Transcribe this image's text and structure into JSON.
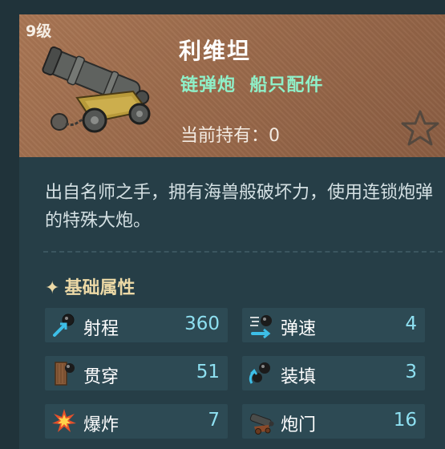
{
  "item": {
    "level": "9级",
    "name": "利维坦",
    "subtitle": "链弹炮  船只配件",
    "owned_label": "当前持有：",
    "owned_count": "0",
    "cannon_icon": "cannon-icon",
    "favorite_icon": "star-icon"
  },
  "description": "出自名师之手，拥有海兽般破坏力，使用连锁炮弹的特殊大炮。",
  "attributes": {
    "title": "基础属性",
    "title_icon": "sparkle-icon",
    "stats": [
      {
        "label": "射程",
        "value": "360",
        "icon": "range-icon"
      },
      {
        "label": "弹速",
        "value": "4",
        "icon": "bullet-speed-icon"
      },
      {
        "label": "贯穿",
        "value": "51",
        "icon": "penetration-icon"
      },
      {
        "label": "装填",
        "value": "3",
        "icon": "reload-icon"
      },
      {
        "label": "爆炸",
        "value": "7",
        "icon": "explosion-icon"
      },
      {
        "label": "炮门",
        "value": "16",
        "icon": "cannon-port-icon"
      }
    ]
  },
  "colors": {
    "value": "#8ee0f1",
    "subtitle": "#8ff0c8",
    "section": "#ecd9a6",
    "panel": "#263e47"
  }
}
